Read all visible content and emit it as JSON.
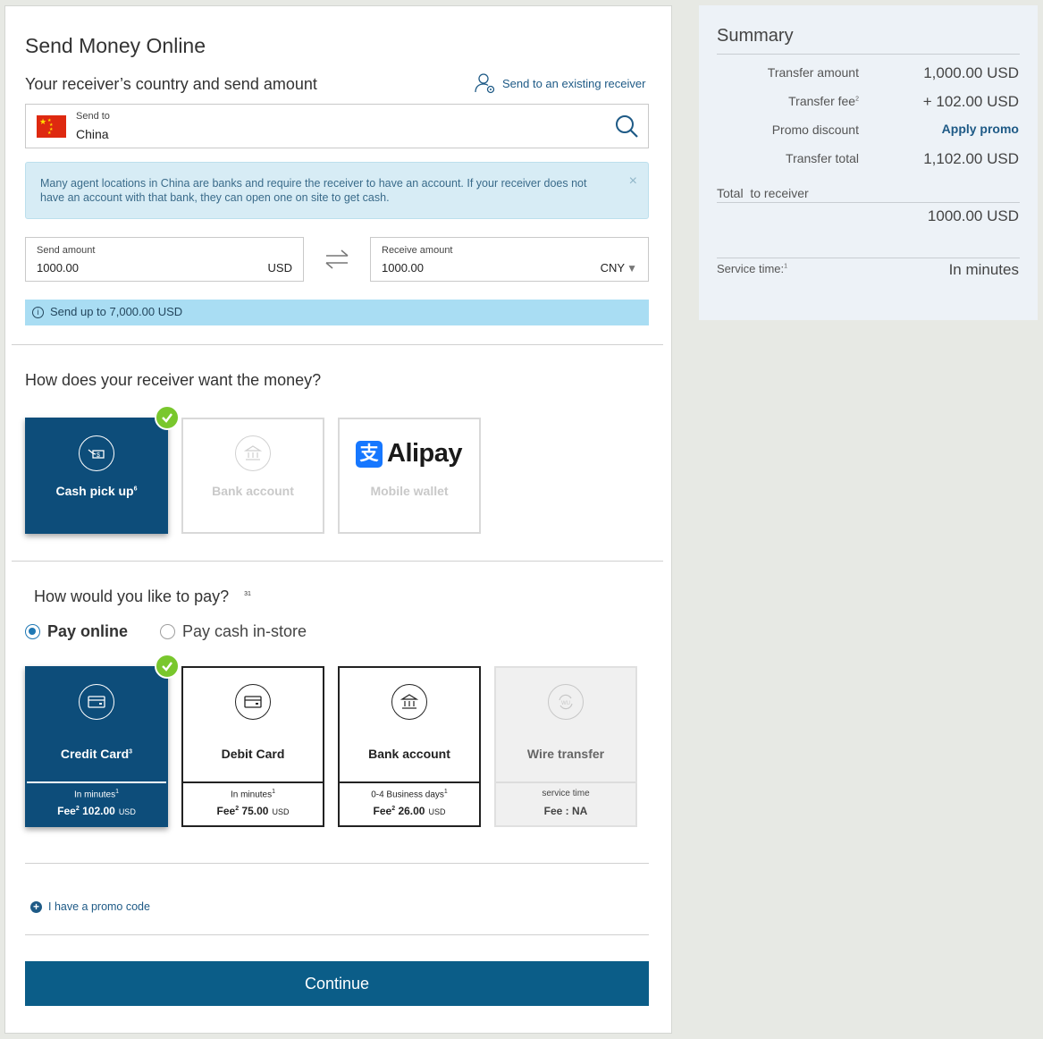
{
  "form": {
    "title": "Send Money Online",
    "receiver_section_title": "Your receiver’s country and send amount",
    "existing_receiver_link": "Send to an existing receiver",
    "send_to_label": "Send to",
    "country": "China",
    "info_banner": "Many agent locations in China are banks and require the receiver to have an account. If your receiver does not have an account with that bank, they can open one on site to get cash.",
    "banner_close": "×",
    "send_amount_label": "Send amount",
    "send_amount": "1000.00",
    "send_currency": "USD",
    "receive_amount_label": "Receive amount",
    "receive_amount": "1000.00",
    "receive_currency": "CNY",
    "receive_currency_caret": "▼",
    "limit_info_icon": "i",
    "limit_banner": "Send up to 7,000.00 USD",
    "receive_method_title": "How does your receiver want the money?",
    "receive_methods": [
      {
        "label": "Cash pick up",
        "sup": "6",
        "icon": "cash-hand-icon",
        "selected": true
      },
      {
        "label": "Bank account",
        "icon": "bank-icon",
        "disabled": true
      },
      {
        "label": "Mobile wallet",
        "brand": "Alipay",
        "brand_mark": "支",
        "icon": "alipay-logo",
        "disabled": true
      }
    ],
    "pay_title": "How would you like to pay?",
    "pay_title_sup": "31",
    "pay_options": [
      {
        "label": "Pay online",
        "selected": true
      },
      {
        "label": "Pay cash in-store",
        "selected": false
      }
    ],
    "payment_methods": [
      {
        "label": "Credit Card",
        "sup": "3",
        "speed": "In minutes",
        "speed_sup": "1",
        "fee_label": "Fee",
        "fee_sup": "2",
        "fee": "102.00",
        "unit": "USD",
        "icon": "credit-card-icon",
        "selected": true
      },
      {
        "label": "Debit Card",
        "speed": "In minutes",
        "speed_sup": "1",
        "fee_label": "Fee",
        "fee_sup": "2",
        "fee": "75.00",
        "unit": "USD",
        "icon": "debit-card-icon"
      },
      {
        "label": "Bank account",
        "speed": "0-4 Business days",
        "speed_sup": "1",
        "fee_label": "Fee",
        "fee_sup": "2",
        "fee": "26.00",
        "unit": "USD",
        "icon": "bank-icon"
      },
      {
        "label": "Wire transfer",
        "speed": "service time",
        "fee_text": "Fee : NA",
        "icon": "wire-transfer-icon",
        "disabled": true
      }
    ],
    "promo_plus": "+",
    "promo_link": "I have a promo code",
    "continue_label": "Continue"
  },
  "summary": {
    "title": "Summary",
    "transfer_amount_label": "Transfer amount",
    "transfer_amount": "1,000.00 USD",
    "transfer_fee_label": "Transfer fee",
    "transfer_fee_sup": "2",
    "transfer_fee": "+ 102.00 USD",
    "promo_label": "Promo discount",
    "promo_action": "Apply promo",
    "total_label": "Transfer total",
    "total": "1,102.00 USD",
    "receiver_total_label": "Total  to receiver",
    "receiver_total": "1000.00 USD",
    "service_time_label": "Service time:",
    "service_time_sup": "1",
    "service_time": "In minutes"
  },
  "colors": {
    "primary": "#0d4d7a",
    "button": "#0b5d88",
    "check": "#79c72d",
    "link": "#1e5a86",
    "info_banner": "#d7ecf5",
    "limit_banner": "#a9ddf3"
  }
}
